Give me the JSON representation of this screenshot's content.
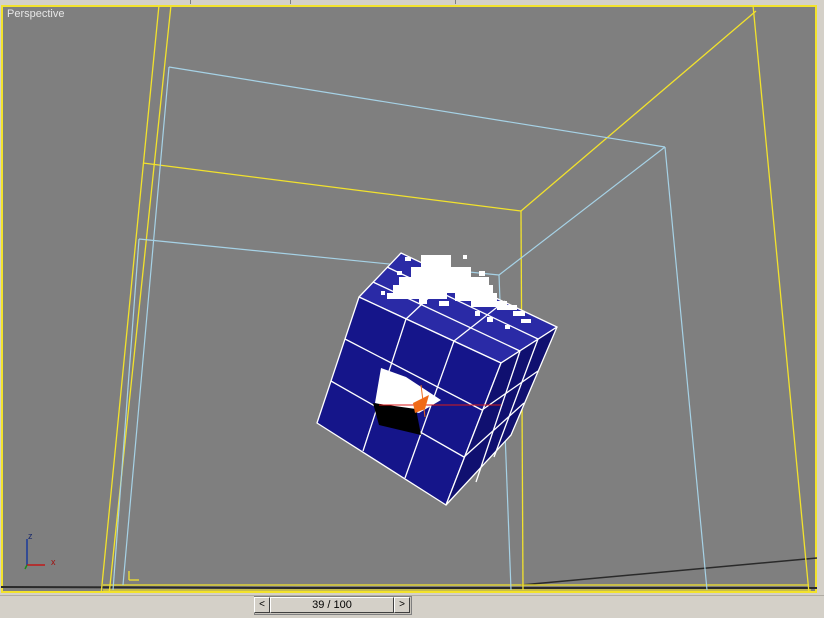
{
  "viewport": {
    "label": "Perspective"
  },
  "timeslider": {
    "frame_text": "39 / 100",
    "prev_symbol": "<",
    "next_symbol": ">"
  },
  "axis_tripod": {
    "z": "z",
    "x": "x"
  },
  "colors": {
    "viewport_bg": "#7f7f7f",
    "active_border": "#f2e22c",
    "room_yellow": "#f2e22c",
    "room_blue": "#a6d2e6",
    "cube_blue": "#15158a"
  }
}
